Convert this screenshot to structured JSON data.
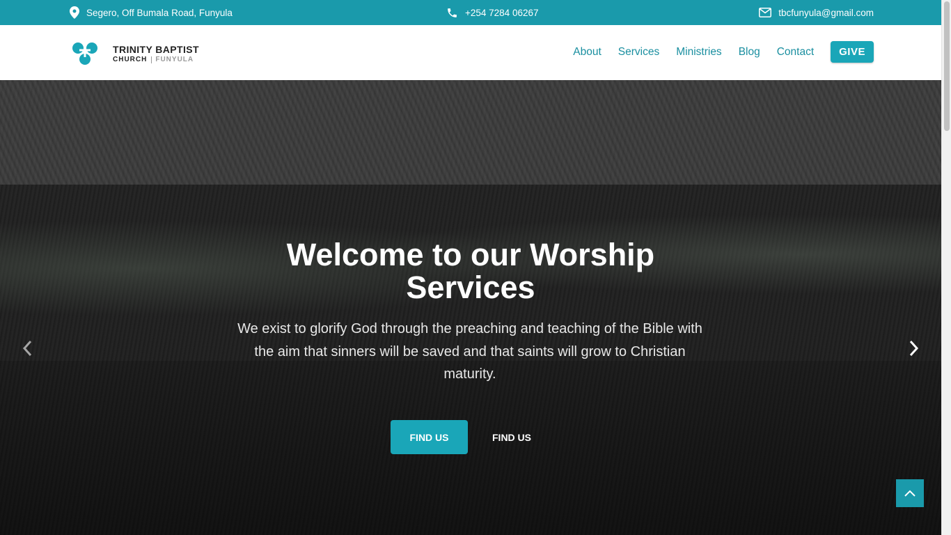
{
  "topbar": {
    "address": "Segero, Off Bumala Road, Funyula",
    "phone": "+254 7284 06267",
    "email": "tbcfunyula@gmail.com"
  },
  "logo": {
    "title": "TRINITY BAPTIST",
    "sub": "CHURCH",
    "location": "FUNYULA"
  },
  "nav": {
    "items": [
      "About",
      "Services",
      "Ministries",
      "Blog",
      "Contact"
    ],
    "give": "GIVE"
  },
  "hero": {
    "title": "Welcome to our Worship Services",
    "text": "We exist to glorify God through the preaching and teaching of the Bible with the aim that sinners will be saved and that saints will grow to Christian maturity.",
    "primary_button": "FIND US",
    "secondary_button": "FIND US"
  },
  "colors": {
    "accent": "#1a9aab",
    "button": "#1aa6b8"
  }
}
